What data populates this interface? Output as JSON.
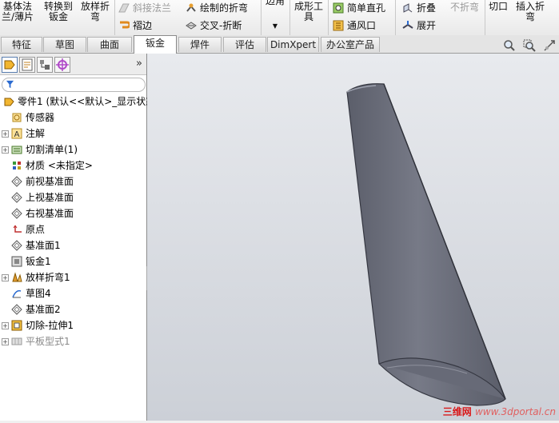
{
  "ribbon": {
    "base_flange": "基体法\n兰/薄片",
    "convert": "转换到\n钣金",
    "lofted_bend": "放样折\n弯",
    "miter_flange": "斜接法兰",
    "hem": "褶边",
    "sketched_bend": "绘制的折弯",
    "cross_break": "交叉-折断",
    "edge": "边角",
    "forming_tool": "成形工\n具",
    "simple_hole": "简单直孔",
    "vent": "通风口",
    "fold": "折叠",
    "unfold": "展开",
    "no_bends": "不折弯",
    "rip": "切口",
    "insert_bends": "插入折\n弯"
  },
  "tabs": [
    "特征",
    "草图",
    "曲面",
    "钣金",
    "焊件",
    "评估",
    "DimXpert",
    "办公室产品"
  ],
  "active_tab": "钣金",
  "panel": {
    "collapse_label": "»"
  },
  "tree": [
    {
      "label": "零件1  (默认<<默认>_显示状态",
      "icon": "part-icon",
      "level": 0,
      "expand": false,
      "dim": false
    },
    {
      "label": "传感器",
      "icon": "sensor-icon",
      "level": 1,
      "expand": false,
      "dim": false
    },
    {
      "label": "注解",
      "icon": "annotation-icon",
      "level": 1,
      "expand": true,
      "dim": false
    },
    {
      "label": "切割清单(1)",
      "icon": "cut-list-icon",
      "level": 1,
      "expand": true,
      "dim": false
    },
    {
      "label": "材质 <未指定>",
      "icon": "material-icon",
      "level": 1,
      "expand": false,
      "dim": false
    },
    {
      "label": "前视基准面",
      "icon": "plane-icon",
      "level": 1,
      "expand": false,
      "dim": false
    },
    {
      "label": "上视基准面",
      "icon": "plane-icon",
      "level": 1,
      "expand": false,
      "dim": false
    },
    {
      "label": "右视基准面",
      "icon": "plane-icon",
      "level": 1,
      "expand": false,
      "dim": false
    },
    {
      "label": "原点",
      "icon": "origin-icon",
      "level": 1,
      "expand": false,
      "dim": false
    },
    {
      "label": "基准面1",
      "icon": "plane-icon",
      "level": 1,
      "expand": false,
      "dim": false
    },
    {
      "label": "钣金1",
      "icon": "sheet-metal-icon",
      "level": 1,
      "expand": false,
      "dim": false
    },
    {
      "label": "放样折弯1",
      "icon": "lofted-bend-icon",
      "level": 1,
      "expand": true,
      "dim": false
    },
    {
      "label": "草图4",
      "icon": "sketch-icon",
      "level": 1,
      "expand": false,
      "dim": false
    },
    {
      "label": "基准面2",
      "icon": "plane-icon",
      "level": 1,
      "expand": false,
      "dim": false
    },
    {
      "label": "切除-拉伸1",
      "icon": "cut-extrude-icon",
      "level": 1,
      "expand": true,
      "dim": false
    },
    {
      "label": "平板型式1",
      "icon": "flat-pattern-icon",
      "level": 1,
      "expand": true,
      "dim": true
    }
  ],
  "watermark": {
    "brand": "三维网",
    "url": "www.3dportal.cn"
  },
  "colors": {
    "model": "#6c6f7c",
    "model_edge": "#3a3c44",
    "viewport_top": "#e8eaee",
    "watermark": "#d9191a"
  }
}
